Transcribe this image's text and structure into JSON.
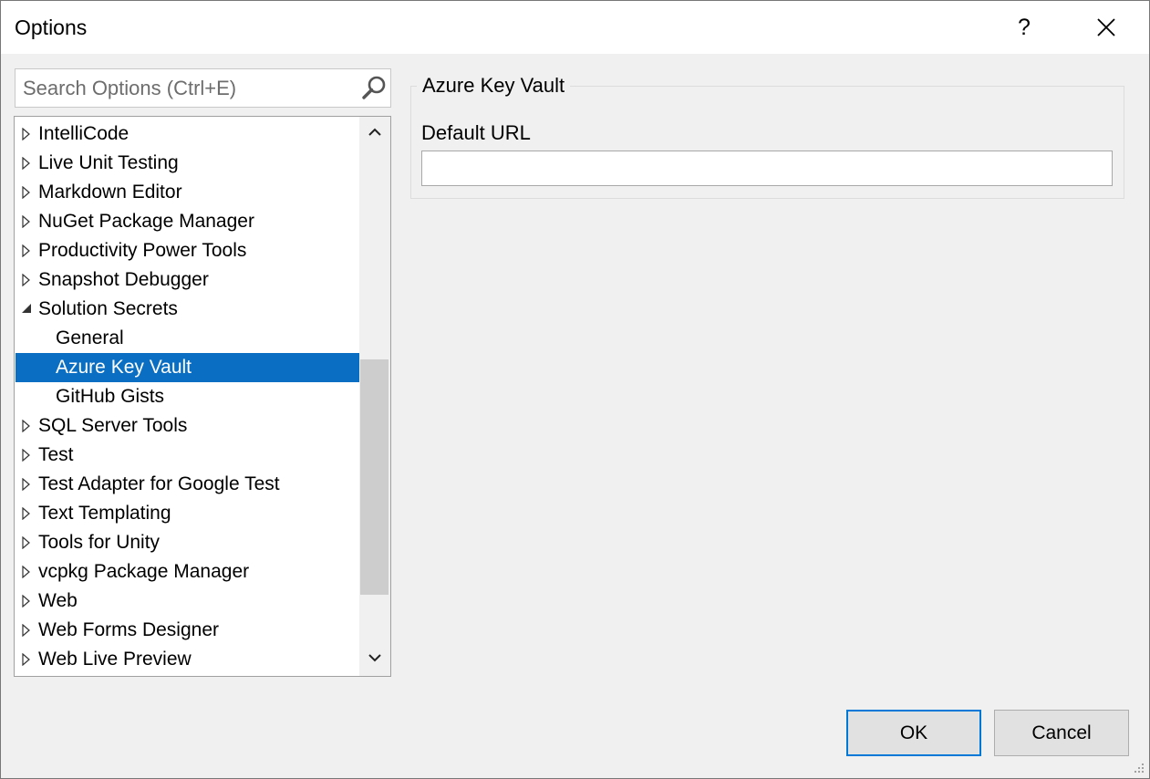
{
  "window": {
    "title": "Options",
    "help_label": "?",
    "close_icon": "close-icon"
  },
  "search": {
    "placeholder": "Search Options (Ctrl+E)",
    "value": "",
    "icon": "search-icon"
  },
  "tree": {
    "items": [
      {
        "label": "IntelliCode",
        "state": "collapsed"
      },
      {
        "label": "Live Unit Testing",
        "state": "collapsed"
      },
      {
        "label": "Markdown Editor",
        "state": "collapsed"
      },
      {
        "label": "NuGet Package Manager",
        "state": "collapsed"
      },
      {
        "label": "Productivity Power Tools",
        "state": "collapsed"
      },
      {
        "label": "Snapshot Debugger",
        "state": "collapsed"
      },
      {
        "label": "Solution Secrets",
        "state": "expanded"
      },
      {
        "label": "General",
        "state": "child"
      },
      {
        "label": "Azure Key Vault",
        "state": "child",
        "selected": true
      },
      {
        "label": "GitHub Gists",
        "state": "child"
      },
      {
        "label": "SQL Server Tools",
        "state": "collapsed"
      },
      {
        "label": "Test",
        "state": "collapsed"
      },
      {
        "label": "Test Adapter for Google Test",
        "state": "collapsed"
      },
      {
        "label": "Text Templating",
        "state": "collapsed"
      },
      {
        "label": "Tools for Unity",
        "state": "collapsed"
      },
      {
        "label": "vcpkg Package Manager",
        "state": "collapsed"
      },
      {
        "label": "Web",
        "state": "collapsed"
      },
      {
        "label": "Web Forms Designer",
        "state": "collapsed"
      },
      {
        "label": "Web Live Preview",
        "state": "collapsed"
      }
    ]
  },
  "panel": {
    "group_title": "Azure Key Vault",
    "field_label": "Default URL",
    "field_value": ""
  },
  "buttons": {
    "ok": "OK",
    "cancel": "Cancel"
  },
  "colors": {
    "selection": "#0a6fc2",
    "default_button_border": "#0078d7"
  }
}
